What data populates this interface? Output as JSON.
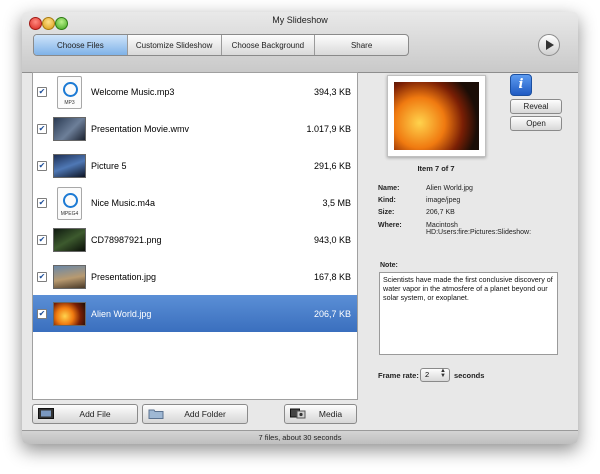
{
  "window": {
    "title": "My Slideshow"
  },
  "tabs": [
    "Choose Files",
    "Customize Slideshow",
    "Choose Background",
    "Share"
  ],
  "files": [
    {
      "name": "Welcome Music.mp3",
      "size": "394,3 KB",
      "checked": true,
      "icon": "audio-file-icon",
      "icon_text": "MP3"
    },
    {
      "name": "Presentation Movie.wmv",
      "size": "1.017,9 KB",
      "checked": true,
      "icon": "movie-thumbnail-icon"
    },
    {
      "name": "Picture 5",
      "size": "291,6 KB",
      "checked": true,
      "icon": "picture-thumbnail-icon"
    },
    {
      "name": "Nice Music.m4a",
      "size": "3,5 MB",
      "checked": true,
      "icon": "audio-file-icon",
      "icon_text": "MPEG4"
    },
    {
      "name": "CD78987921.png",
      "size": "943,0 KB",
      "checked": true,
      "icon": "picture-thumbnail-icon"
    },
    {
      "name": "Presentation.jpg",
      "size": "167,8 KB",
      "checked": true,
      "icon": "picture-thumbnail-icon"
    },
    {
      "name": "Alien World.jpg",
      "size": "206,7 KB",
      "checked": true,
      "icon": "picture-thumbnail-icon",
      "selected": true
    }
  ],
  "buttons": {
    "add_file": "Add File",
    "add_folder": "Add Folder",
    "media": "Media",
    "reveal": "Reveal",
    "open": "Open"
  },
  "preview": {
    "item_count": "Item 7 of 7",
    "labels": {
      "name": "Name:",
      "kind": "Kind:",
      "size": "Size:",
      "where": "Where:"
    },
    "name": "Alien World.jpg",
    "kind": "image/jpeg",
    "size": "206,7 KB",
    "where": "Macintosh HD:Users:fire:Pictures:Slideshow:"
  },
  "note": {
    "label": "Note:",
    "text": "Scientists have made the first conclusive discovery of water vapor in the atmosfere of a planet beyond our solar system, or exoplanet."
  },
  "frame_rate": {
    "label": "Frame rate:",
    "value": "2",
    "unit": "seconds"
  },
  "status": "7 files, about 30 seconds",
  "colors": {
    "selection": "#3f74c4",
    "accent": "#1f5ac2"
  }
}
